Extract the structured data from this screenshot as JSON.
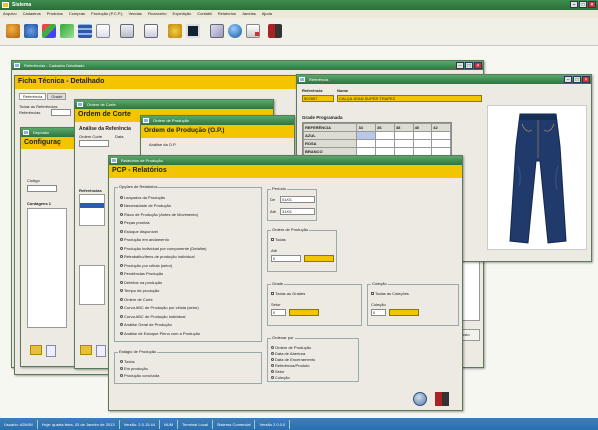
{
  "app": {
    "title": "Sistema",
    "menu": [
      "Arquivo",
      "Cadastros",
      "Produtos",
      "Compras",
      "Produção (P.C.P.)",
      "Vendas",
      "Financeiro",
      "Expedição",
      "Contábil",
      "Relatórios",
      "Janelas",
      "Ajuda"
    ]
  },
  "toolbar_icons": [
    "users-icon",
    "gear-icon",
    "chart-icon",
    "chart2-icon",
    "grid-icon",
    "document-icon",
    "clipboard-icon",
    "calendar-icon",
    "heart-icon",
    "stop-icon",
    "palette-icon",
    "globe-icon",
    "report-icon",
    "exit-icon"
  ],
  "win_bg": {
    "title": "Referências - Cadastro Detalhado"
  },
  "ficha": {
    "title": "Ficha Técnica - Detalhado",
    "tab1": "Referência",
    "tab2": "Grade",
    "lbl1": "Todas as Referências",
    "lbl2": "Referências"
  },
  "config": {
    "header": "Configuraç",
    "lbl_codigo": "Código",
    "lbl_contagens": "Contagens 1"
  },
  "ordem_corte": {
    "title": "Ordem de Corte",
    "sub": "Análise da Referência",
    "lbl_ordem": "Ordem Corte",
    "lbl_data": "Data",
    "lbl_referencias": "Referências"
  },
  "ordem_prod": {
    "win_title": "Ordem de Produção",
    "header": "Ordem de Produção (O.P.)",
    "sub": "Análise da O.P."
  },
  "referencia": {
    "win_title": "Referência",
    "lbl_ref": "Referência",
    "lbl_nome": "Nome",
    "ref_value": "507897",
    "nome_value": "CALÇA JEAN SUPER TRAPEZ",
    "grade_label": "Grade Programada",
    "grade_cols": [
      "REFERÊNCIA",
      "34",
      "36",
      "38",
      "40",
      "42"
    ],
    "grade_rows": [
      "AZUL",
      "ROSA",
      "BRANCO",
      "CINZA",
      "VERMELHO",
      "PRETO",
      "T1"
    ],
    "footer_note": "Ficha SNC para cast"
  },
  "pcp": {
    "win_title": "Relatórios de Produção",
    "header": "PCP - Relatórios",
    "group_opcoes": "Opções de Relatórios",
    "options": [
      "Lançados da Produção",
      "Necessidade de Produção",
      "Risco de Produção (Antes de Movimento)",
      "Peças prontas",
      "Estoque disponível",
      "Produção em andamento",
      "Produção individual por componente (Detalhe)",
      "Retrabalho/Itens de produção individual",
      "Produção por célula (setor)",
      "Pendências Produção",
      "Defeitos na produção",
      "Tempo de produção",
      "Ordem de Corte",
      "Curva ABC de Produção por célula (setor)",
      "Curva ABC de Produção individual",
      "Análise Geral de Produção",
      "Análise de Estoque Pleno com a Produção"
    ],
    "group_periodo": "Período",
    "lbl_de": "De",
    "lbl_ate": "Até",
    "date_de": "01/01",
    "date_ate": "31/01",
    "group_ordem": "Ordem de Produção",
    "chk_todas_ordens": "Todas",
    "lbl_ate2": "Até",
    "group_grade": "Grade",
    "chk_todas_grades": "Todas as Grades",
    "group_setor": "Setor",
    "chk_todos_setores": "Todos os Setores",
    "group_colecao": "Coleção",
    "chk_todas_colecoes": "Todas as Coleções",
    "group_estagio": "Estágio de Produção",
    "estagios": [
      "Todos",
      "Em produção",
      "Produção concluída"
    ],
    "group_ordenar": "Ordenar por",
    "ordenar": [
      "Ordem de Produção",
      "Data de Abertura",
      "Data de Encerramento",
      "Referência/Produto",
      "Setor",
      "Coleção"
    ],
    "small_field_value": "0"
  },
  "side_btn": "Atualizar Custo",
  "statusbar": [
    "Usuário: ADMIN",
    "Hoje: quarta-feira, 03 de Janeiro de 2013",
    "Versão: 2.0.15.44",
    "NUM",
    "Terminal Local",
    "Sistema Comercial",
    "Versão 2.0.0.0"
  ],
  "colors": {
    "accent_yellow": "#f2c500",
    "titlebar_green": "#2f7440",
    "status_blue": "#2a6fb0"
  }
}
